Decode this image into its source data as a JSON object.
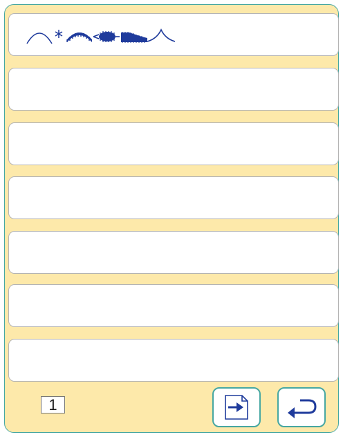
{
  "window": {
    "background": "#fde9aa",
    "border_color": "#46a7a2"
  },
  "stitch_slots": [
    {
      "index": 1,
      "stitches": [
        "arc-stitch-icon",
        "asterisk-stitch-icon",
        "scallop-satin-stitch-icon",
        "oval-satin-stitch-icon",
        "ramp-satin-stitch-icon",
        "peak-stitch-icon"
      ]
    },
    {
      "index": 2,
      "stitches": []
    },
    {
      "index": 3,
      "stitches": []
    },
    {
      "index": 4,
      "stitches": []
    },
    {
      "index": 5,
      "stitches": []
    },
    {
      "index": 6,
      "stitches": []
    },
    {
      "index": 7,
      "stitches": []
    }
  ],
  "stitch_color": "#1f3b9c",
  "footer": {
    "page_number": "1",
    "next_button_icon": "page-arrow-right-icon",
    "back_button_icon": "return-arrow-icon"
  }
}
